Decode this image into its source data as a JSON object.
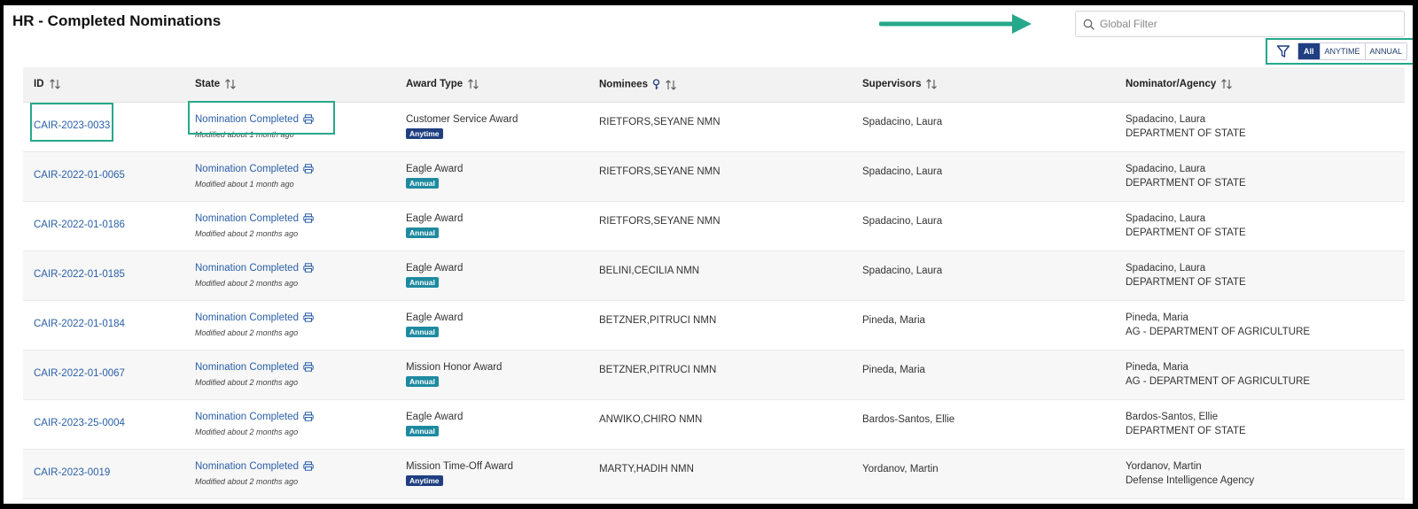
{
  "page": {
    "title": "HR - Completed Nominations"
  },
  "search": {
    "placeholder": "Global Filter"
  },
  "filters": {
    "options": [
      "All",
      "ANYTIME",
      "ANNUAL"
    ],
    "selected": "All"
  },
  "colors": {
    "annotation": "#26a88a",
    "link": "#2a5fa8",
    "anytime_badge": "#1f3f80",
    "annual_badge": "#1e8aa0"
  },
  "table": {
    "columns": [
      "ID",
      "State",
      "Award Type",
      "Nominees",
      "Supervisors",
      "Nominator/Agency"
    ],
    "rows": [
      {
        "id": "CAIR-2023-0033",
        "state": "Nomination Completed",
        "modified": "Modified about 1 month ago",
        "award": "Customer Service Award",
        "badge": "Anytime",
        "nominee": "RIETFORS,SEYANE NMN",
        "supervisor": "Spadacino, Laura",
        "nominator": "Spadacino, Laura",
        "agency": "DEPARTMENT OF STATE"
      },
      {
        "id": "CAIR-2022-01-0065",
        "state": "Nomination Completed",
        "modified": "Modified about 1 month ago",
        "award": "Eagle Award",
        "badge": "Annual",
        "nominee": "RIETFORS,SEYANE NMN",
        "supervisor": "Spadacino, Laura",
        "nominator": "Spadacino, Laura",
        "agency": "DEPARTMENT OF STATE"
      },
      {
        "id": "CAIR-2022-01-0186",
        "state": "Nomination Completed",
        "modified": "Modified about 2 months ago",
        "award": "Eagle Award",
        "badge": "Annual",
        "nominee": "RIETFORS,SEYANE NMN",
        "supervisor": "Spadacino, Laura",
        "nominator": "Spadacino, Laura",
        "agency": "DEPARTMENT OF STATE"
      },
      {
        "id": "CAIR-2022-01-0185",
        "state": "Nomination Completed",
        "modified": "Modified about 2 months ago",
        "award": "Eagle Award",
        "badge": "Annual",
        "nominee": "BELINI,CECILIA NMN",
        "supervisor": "Spadacino, Laura",
        "nominator": "Spadacino, Laura",
        "agency": "DEPARTMENT OF STATE"
      },
      {
        "id": "CAIR-2022-01-0184",
        "state": "Nomination Completed",
        "modified": "Modified about 2 months ago",
        "award": "Eagle Award",
        "badge": "Annual",
        "nominee": "BETZNER,PITRUCI NMN",
        "supervisor": "Pineda, Maria",
        "nominator": "Pineda, Maria",
        "agency": "AG - DEPARTMENT OF AGRICULTURE"
      },
      {
        "id": "CAIR-2022-01-0067",
        "state": "Nomination Completed",
        "modified": "Modified about 2 months ago",
        "award": "Mission Honor Award",
        "badge": "Annual",
        "nominee": "BETZNER,PITRUCI NMN",
        "supervisor": "Pineda, Maria",
        "nominator": "Pineda, Maria",
        "agency": "AG - DEPARTMENT OF AGRICULTURE"
      },
      {
        "id": "CAIR-2023-25-0004",
        "state": "Nomination Completed",
        "modified": "Modified about 2 months ago",
        "award": "Eagle Award",
        "badge": "Annual",
        "nominee": "ANWIKO,CHIRO NMN",
        "supervisor": "Bardos-Santos, Ellie",
        "nominator": "Bardos-Santos, Ellie",
        "agency": "DEPARTMENT OF STATE"
      },
      {
        "id": "CAIR-2023-0019",
        "state": "Nomination Completed",
        "modified": "Modified about 2 months ago",
        "award": "Mission Time-Off Award",
        "badge": "Anytime",
        "nominee": "MARTY,HADIH NMN",
        "supervisor": "Yordanov, Martin",
        "nominator": "Yordanov, Martin",
        "agency": "Defense Intelligence Agency"
      }
    ]
  }
}
